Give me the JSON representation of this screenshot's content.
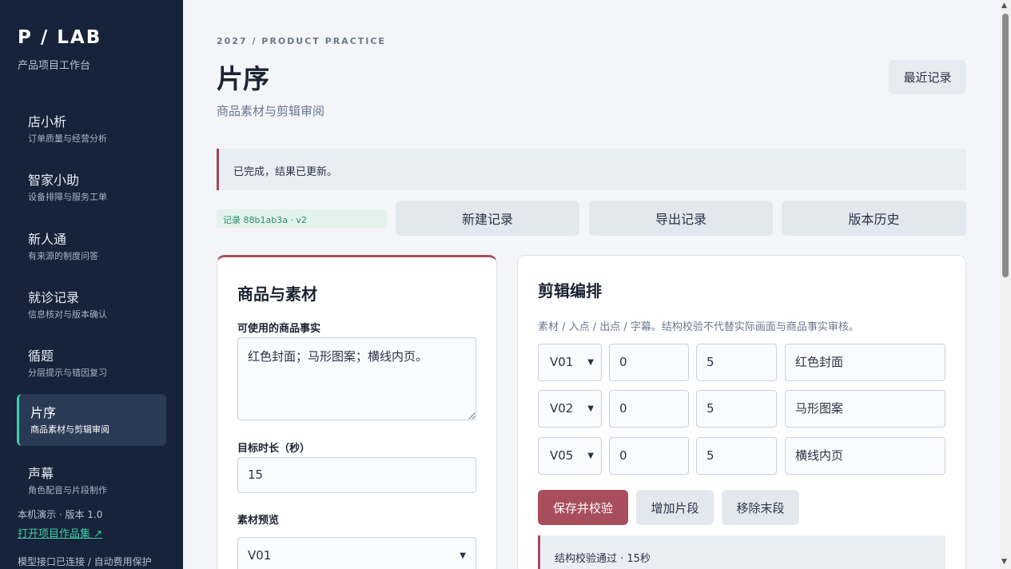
{
  "sidebar": {
    "brand": "P / LAB",
    "brand_sub": "产品项目工作台",
    "items": [
      {
        "title": "店小析",
        "sub": "订单质量与经营分析"
      },
      {
        "title": "智家小助",
        "sub": "设备排障与服务工单"
      },
      {
        "title": "新人通",
        "sub": "有来源的制度问答"
      },
      {
        "title": "就诊记录",
        "sub": "信息核对与版本确认"
      },
      {
        "title": "循题",
        "sub": "分层提示与错因复习"
      },
      {
        "title": "片序",
        "sub": "商品素材与剪辑审阅"
      },
      {
        "title": "声幕",
        "sub": "角色配音与片段制作"
      }
    ],
    "foot_version": "本机演示 · 版本 1.0",
    "foot_link": "打开项目作品集 ↗",
    "foot_status": "模型接口已连接 / 自动费用保护"
  },
  "header": {
    "eyebrow": "2027 / PRODUCT PRACTICE",
    "title": "片序",
    "subtitle": "商品素材与剪辑审阅",
    "recent_label": "最近记录"
  },
  "alert": "已完成，结果已更新。",
  "toolbar": {
    "record_tag": "记录 88b1ab3a · v2",
    "new_label": "新建记录",
    "export_label": "导出记录",
    "history_label": "版本历史"
  },
  "left_card": {
    "title": "商品与素材",
    "facts_label": "可使用的商品事实",
    "facts_value": "红色封面；马形图案；横线内页。",
    "duration_label": "目标时长（秒）",
    "duration_value": "15",
    "preview_label": "素材预览",
    "preview_value": "V01"
  },
  "right_card": {
    "title": "剪辑编排",
    "hint": "素材 / 入点 / 出点 / 字幕。结构校验不代替实际画面与商品事实审核。",
    "segments": [
      {
        "clip": "V01",
        "in": "0",
        "out": "5",
        "caption": "红色封面"
      },
      {
        "clip": "V02",
        "in": "0",
        "out": "5",
        "caption": "马形图案"
      },
      {
        "clip": "V05",
        "in": "0",
        "out": "5",
        "caption": "横线内页"
      }
    ],
    "save_label": "保存并校验",
    "add_label": "增加片段",
    "remove_label": "移除末段",
    "result": "结构校验通过 · 15秒"
  },
  "colors": {
    "sidebar_bg": "#16233a",
    "accent": "#a84d5b",
    "active_marker": "#3fd0a6"
  }
}
